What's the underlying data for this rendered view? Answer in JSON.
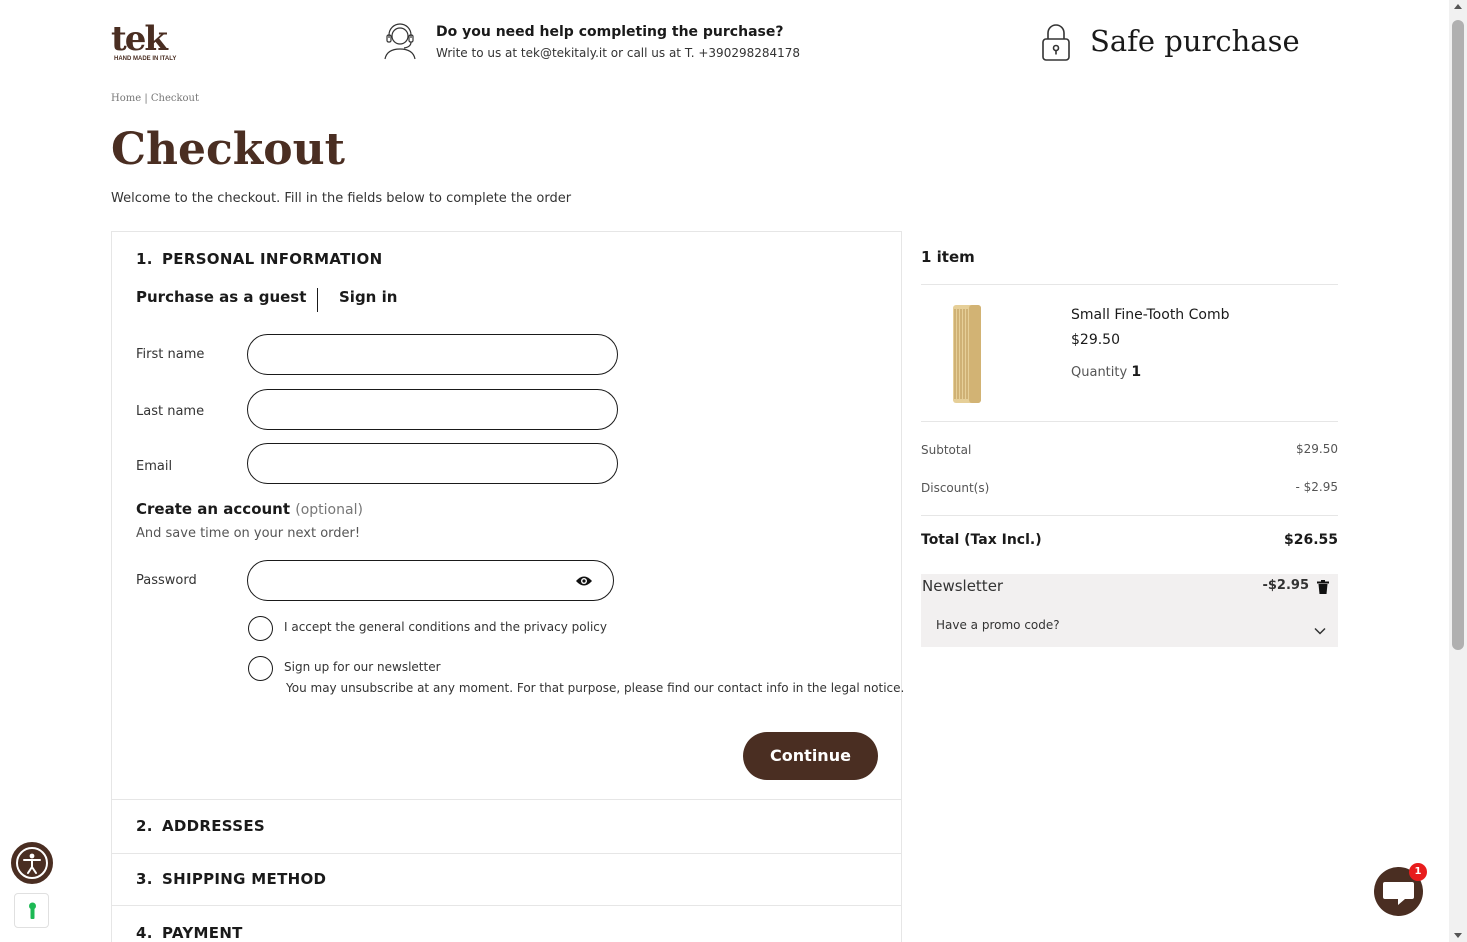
{
  "header": {
    "logo_text": "tek",
    "logo_tagline": "HAND MADE IN ITALY",
    "help_title": "Do you need help completing the purchase?",
    "help_subtitle": "Write to us at tek@tekitaly.it or call us at T. +390298284178",
    "safe_purchase": "Safe purchase"
  },
  "breadcrumb": "Home | Checkout",
  "page": {
    "title": "Checkout",
    "welcome": "Welcome to the checkout. Fill in the fields below to complete the order"
  },
  "steps": [
    {
      "num": "1.",
      "label": "PERSONAL INFORMATION"
    },
    {
      "num": "2.",
      "label": "ADDRESSES"
    },
    {
      "num": "3.",
      "label": "SHIPPING METHOD"
    },
    {
      "num": "4.",
      "label": "PAYMENT"
    }
  ],
  "personal": {
    "tab_guest": "Purchase as a guest",
    "tab_signin": "Sign in",
    "first_name_label": "First name",
    "last_name_label": "Last name",
    "email_label": "Email",
    "first_name_value": "",
    "last_name_value": "",
    "email_value": "",
    "create_account": "Create an account",
    "optional": "(optional)",
    "create_sub": "And save time on your next order!",
    "password_label": "Password",
    "password_value": "",
    "accept_terms": "I accept the general conditions and the privacy policy",
    "newsletter": "Sign up for our newsletter",
    "newsletter_note": "You may unsubscribe at any moment. For that purpose, please find our contact info in the legal notice.",
    "continue": "Continue"
  },
  "summary": {
    "items_count": "1 item",
    "product_name": "Small Fine-Tooth Comb",
    "product_price": "$29.50",
    "quantity_label": "Quantity",
    "quantity_value": "1",
    "subtotal_label": "Subtotal",
    "subtotal_value": "$29.50",
    "discount_label": "Discount(s)",
    "discount_value": "- $2.95",
    "total_label": "Total (Tax Incl.)",
    "total_value": "$26.55",
    "promo_name": "Newsletter",
    "promo_amount": "-$2.95",
    "promo_toggle": "Have a promo code?"
  },
  "chat": {
    "badge": "1"
  },
  "colors": {
    "brand": "#4a2e22",
    "badge": "#e81c1c",
    "promo_bg": "#f2f0f0"
  }
}
